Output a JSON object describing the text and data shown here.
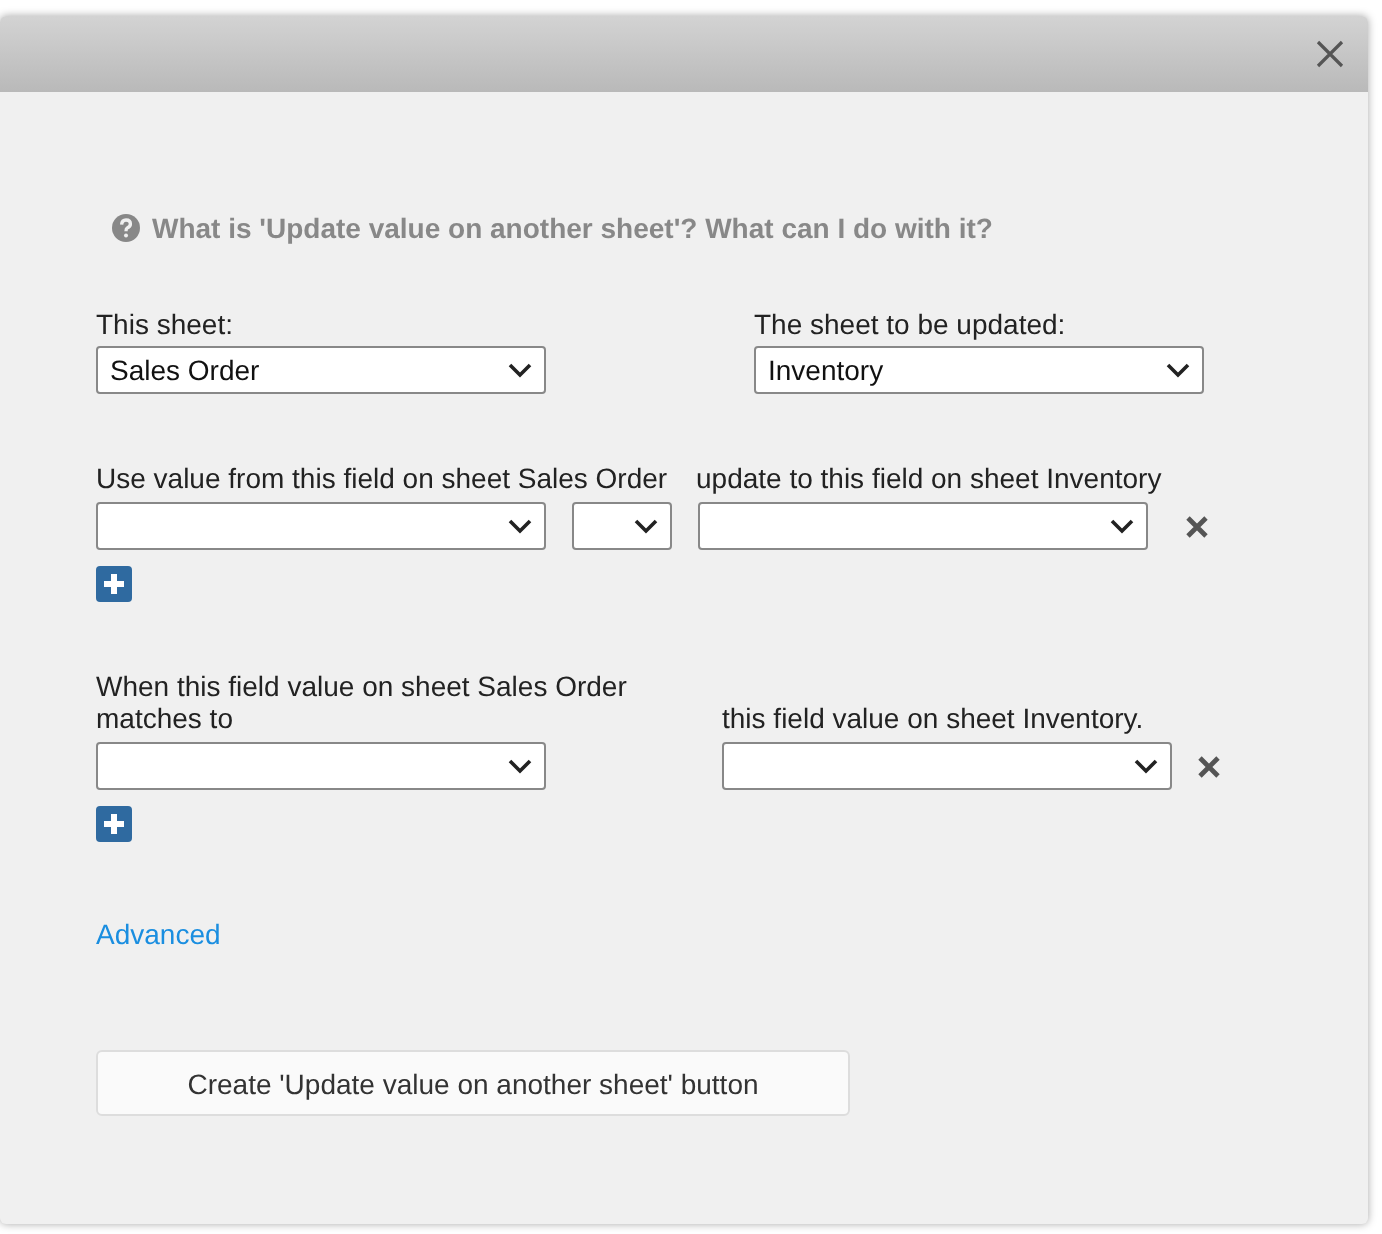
{
  "help_link": "What is 'Update value on another sheet'? What can I do with it?",
  "this_sheet": {
    "label": "This sheet:",
    "value": "Sales Order"
  },
  "target_sheet": {
    "label": "The sheet to be updated:",
    "value": "Inventory"
  },
  "update_section": {
    "source_label": "Use value from this field on sheet Sales Order",
    "target_label": "update to this field on sheet Inventory"
  },
  "match_section": {
    "source_label": "When this field value on sheet Sales Order matches to",
    "target_label": "this field value on sheet Inventory."
  },
  "advanced_link": "Advanced",
  "create_button": "Create 'Update value on another sheet' button"
}
